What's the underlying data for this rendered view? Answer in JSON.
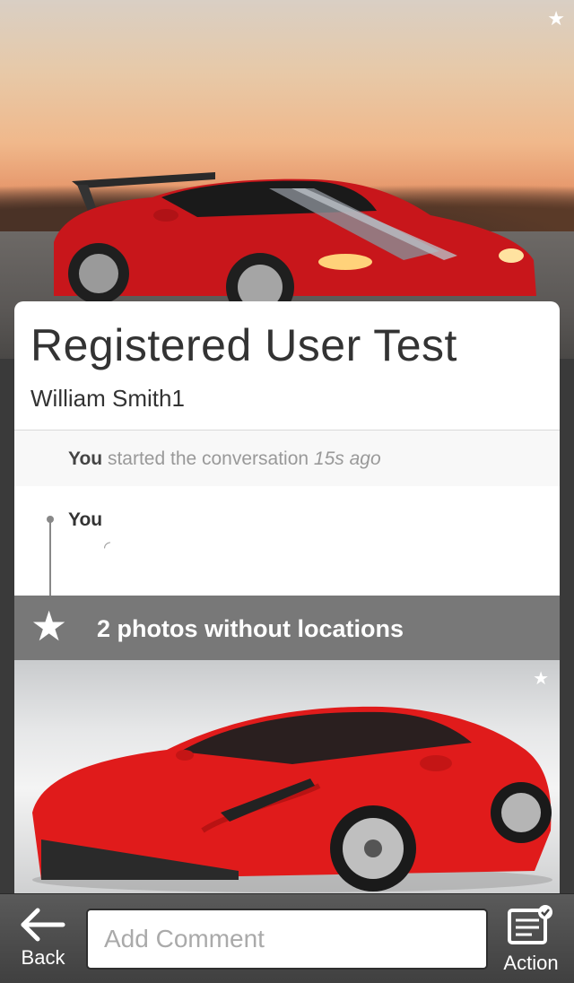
{
  "hero": {
    "favorite_icon": "star-icon"
  },
  "card": {
    "title": "Registered User Test",
    "subtitle": "William Smith1"
  },
  "event": {
    "actor": "You",
    "text": " started the conversation ",
    "time": "15s ago"
  },
  "comment": {
    "author": "You",
    "status_icon": "loading-spinner-icon"
  },
  "photo_banner": {
    "icon": "star-icon",
    "label": "2 photos without locations"
  },
  "toolbar": {
    "back_label": "Back",
    "comment_placeholder": "Add Comment",
    "action_label": "Action"
  },
  "colors": {
    "banner_bg": "#787878",
    "toolbar_bg": "#4a4a4a",
    "car_red": "#d11a1a"
  }
}
